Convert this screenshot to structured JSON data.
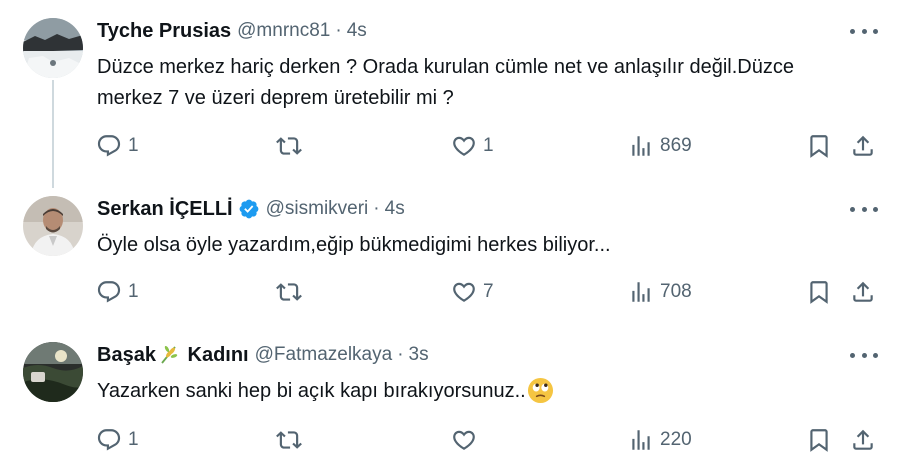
{
  "colors": {
    "text": "#0f1419",
    "secondary": "#536471",
    "verified": "#1d9bf0",
    "thread_line": "#cfd9de"
  },
  "tweets": [
    {
      "name": "Tyche Prusias",
      "handle": "@mnrnc81",
      "separator": "·",
      "time": "4s",
      "verified": false,
      "text": "Düzce merkez hariç derken ? Orada kurulan cümle net ve anlaşılır değil.Düzce merkez 7 ve üzeri deprem üretebilir mi ?",
      "replies": "1",
      "retweets": "",
      "likes": "1",
      "views": "869"
    },
    {
      "name": "Serkan İÇELLİ",
      "handle": "@sismikveri",
      "separator": "·",
      "time": "4s",
      "verified": true,
      "text": "Öyle olsa öyle yazardım,eğip bükmedigimi herkes biliyor...",
      "replies": "1",
      "retweets": "",
      "likes": "7",
      "views": "708"
    },
    {
      "name_before": "Başak",
      "name_after": "Kadını",
      "handle": "@Fatmazelkaya",
      "separator": "·",
      "time": "3s",
      "verified": false,
      "text": "Yazarken sanki hep bi açık kapı bırakıyorsunuz..",
      "replies": "1",
      "retweets": "",
      "likes": "",
      "views": "220"
    }
  ],
  "icons": {
    "reply": "reply-icon",
    "retweet": "retweet-icon",
    "like": "heart-icon",
    "views": "views-chart-icon",
    "bookmark": "bookmark-icon",
    "share": "share-icon",
    "more": "more-dots-icon",
    "verified": "verified-badge-icon",
    "name_emoji": "sheaf-of-rice-icon",
    "text_emoji": "face-with-rolling-eyes-icon"
  }
}
